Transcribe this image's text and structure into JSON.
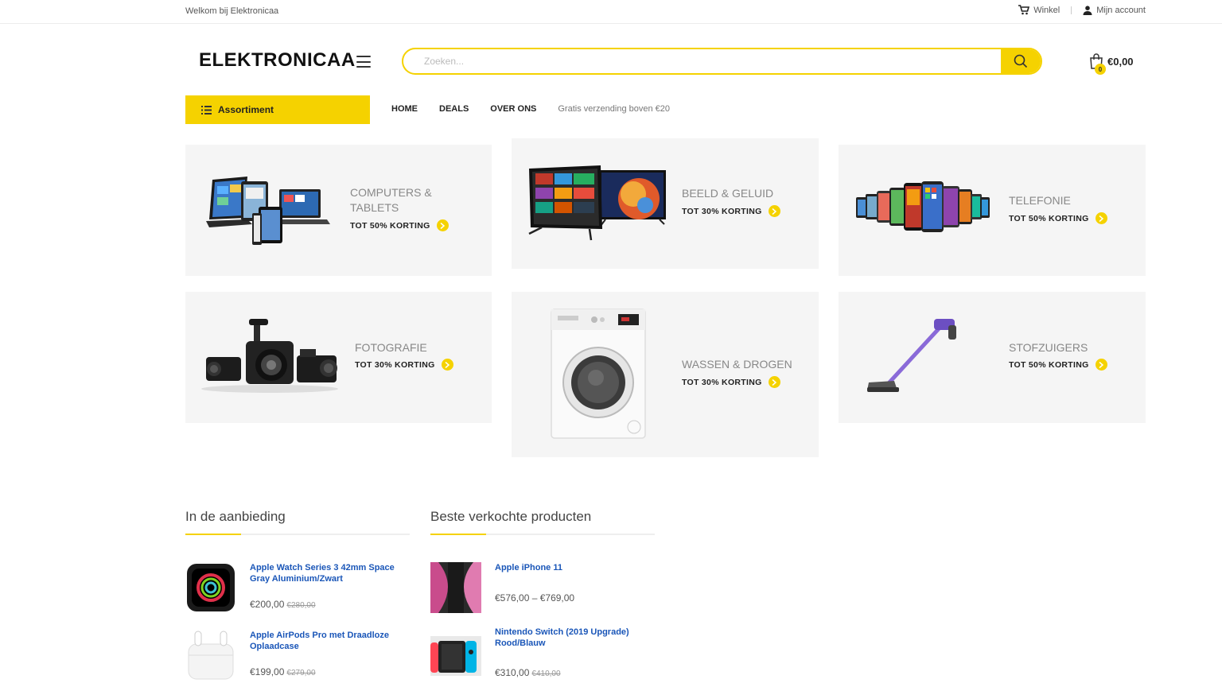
{
  "topbar": {
    "welcome": "Welkom bij Elektronicaa",
    "shop": "Winkel",
    "account": "Mijn account"
  },
  "header": {
    "logo": "ELEKTRONICAA",
    "search_placeholder": "Zoeken...",
    "cart_count": "0",
    "cart_total": "€0,00"
  },
  "nav": {
    "assortment": "Assortiment",
    "items": [
      "HOME",
      "DEALS",
      "OVER ONS"
    ],
    "promo": "Gratis verzending boven €20"
  },
  "categories": [
    {
      "title": "COMPUTERS & TABLETS",
      "discount": "TOT 50% KORTING",
      "icon": "laptop-tablet-icon"
    },
    {
      "title": "BEELD & GELUID",
      "discount": "TOT 30% KORTING",
      "icon": "tv-icon"
    },
    {
      "title": "TELEFONIE",
      "discount": "TOT 50% KORTING",
      "icon": "phones-icon"
    },
    {
      "title": "FOTOGRAFIE",
      "discount": "TOT 30% KORTING",
      "icon": "camera-icon"
    },
    {
      "title": "WASSEN & DROGEN",
      "discount": "TOT 30% KORTING",
      "icon": "washing-machine-icon"
    },
    {
      "title": "STOFZUIGERS",
      "discount": "TOT 50% KORTING",
      "icon": "vacuum-icon"
    }
  ],
  "sale": {
    "title": "In de aanbieding",
    "products": [
      {
        "name": "Apple Watch Series 3 42mm Space Gray Aluminium/Zwart",
        "price": "€200,00",
        "old_price": "€280,00"
      },
      {
        "name": "Apple AirPods Pro met Draadloze Oplaadcase",
        "price": "€199,00",
        "old_price": "€279,00"
      }
    ]
  },
  "best": {
    "title": "Beste verkochte producten",
    "products": [
      {
        "name": "Apple iPhone 11",
        "price": "€576,00 – €769,00"
      },
      {
        "name": "Nintendo Switch (2019 Upgrade) Rood/Blauw",
        "price": "€310,00",
        "old_price": "€410,00"
      }
    ]
  },
  "colors": {
    "accent": "#f5d200",
    "link": "#1a56b8",
    "tile_bg": "#f5f5f5"
  }
}
